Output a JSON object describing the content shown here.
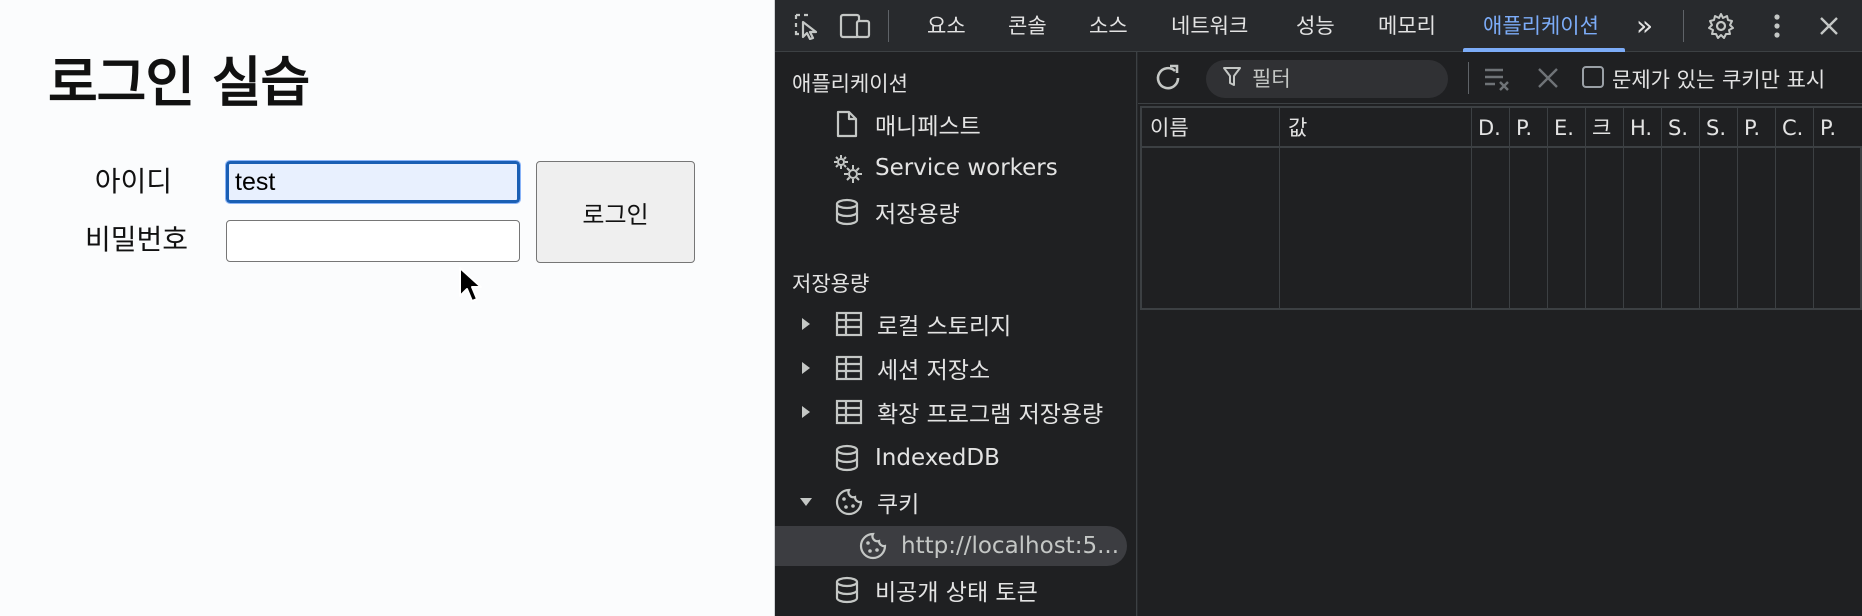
{
  "page": {
    "title": "로그인 실습",
    "id_label": "아이디",
    "pw_label": "비밀번호",
    "id_value": "test",
    "pw_value": "",
    "login_button": "로그인"
  },
  "devtools": {
    "tabs": [
      {
        "label": "요소",
        "active": false
      },
      {
        "label": "콘솔",
        "active": false
      },
      {
        "label": "소스",
        "active": false
      },
      {
        "label": "네트워크",
        "active": false
      },
      {
        "label": "성능",
        "active": false
      },
      {
        "label": "메모리",
        "active": false
      },
      {
        "label": "애플리케이션",
        "active": true
      }
    ],
    "more_tabs": "»",
    "sidebar": {
      "application_heading": "애플리케이션",
      "application_items": [
        {
          "label": "매니페스트",
          "icon": "file-icon"
        },
        {
          "label": "Service workers",
          "icon": "gears-icon"
        },
        {
          "label": "저장용량",
          "icon": "database-icon"
        }
      ],
      "storage_heading": "저장용량",
      "storage_items": [
        {
          "label": "로컬 스토리지",
          "icon": "table-icon",
          "expander": "collapsed"
        },
        {
          "label": "세션 저장소",
          "icon": "table-icon",
          "expander": "collapsed"
        },
        {
          "label": "확장 프로그램 저장용량",
          "icon": "table-icon",
          "expander": "collapsed"
        },
        {
          "label": "IndexedDB",
          "icon": "database-icon",
          "expander": "none"
        },
        {
          "label": "쿠키",
          "icon": "cookie-icon",
          "expander": "expanded"
        },
        {
          "label": "http://localhost:5...",
          "icon": "cookie-icon",
          "expander": "child",
          "selected": true
        },
        {
          "label": "비공개 상태 토큰",
          "icon": "database-icon",
          "expander": "none"
        }
      ]
    },
    "filter": {
      "placeholder": "필터",
      "only_issues_label": "문제가 있는 쿠키만 표시"
    },
    "cookie_columns": [
      "이름",
      "값",
      "D.",
      "P.",
      "E.",
      "크",
      "H.",
      "S.",
      "S.",
      "P.",
      "C.",
      "P."
    ],
    "colors": {
      "accent": "#7cacf8",
      "panel_bg": "#1f2022",
      "toolbar_bg": "#282a2d",
      "focus_border": "#1a5fb4"
    }
  }
}
